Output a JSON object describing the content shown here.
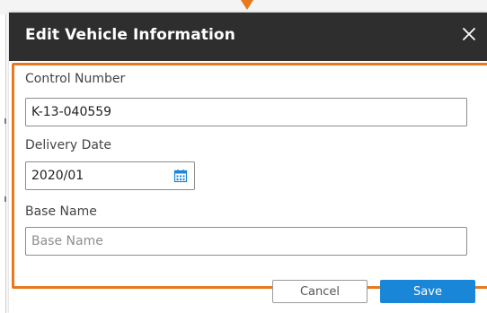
{
  "dialog": {
    "title": "Edit Vehicle Information",
    "close_icon": "close-icon"
  },
  "form": {
    "control_number": {
      "label": "Control Number",
      "value": "K-13-040559"
    },
    "delivery_date": {
      "label": "Delivery Date",
      "value": "2020/01",
      "icon": "calendar-icon"
    },
    "base_name": {
      "label": "Base Name",
      "value": "",
      "placeholder": "Base Name"
    }
  },
  "footer": {
    "cancel_label": "Cancel",
    "save_label": "Save"
  },
  "colors": {
    "header_bg": "#2e2e2e",
    "highlight": "#e8791d",
    "primary": "#1a86d8"
  }
}
